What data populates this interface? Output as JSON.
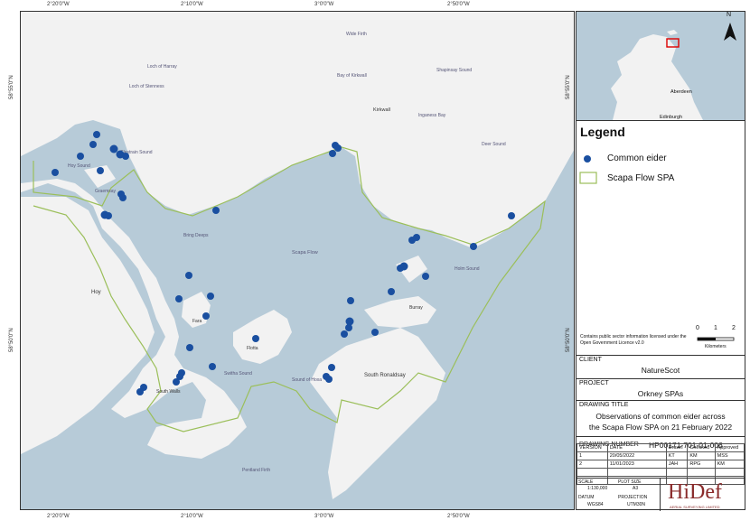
{
  "coords": {
    "top": [
      "2°20'0\"W",
      "2°10'0\"W",
      "3°0'0\"W",
      "2°50'0\"W"
    ],
    "bottom": [
      "2°20'0\"W",
      "2°10'0\"W",
      "3°0'0\"W",
      "2°50'0\"W"
    ],
    "left": [
      "58°55'0\"N",
      "58°50'0\"N"
    ],
    "right": [
      "58°55'0\"N",
      "58°50'0\"N"
    ]
  },
  "places": {
    "wide_firth": "Wide Firth",
    "loch_harray": "Loch of Harray",
    "loch_stenness": "Loch of Stenness",
    "bay_kirkwall": "Bay of Kirkwall",
    "shapinsay_sound": "Shapinsay Sound",
    "kirkwall": "Kirkwall",
    "inganess_bay": "Inganess Bay",
    "deer_sound": "Deer Sound",
    "hoy_sound": "Hoy Sound",
    "clestrain_sound": "Clestrain Sound",
    "graemsay": "Graemsay",
    "bring_deeps": "Bring Deeps",
    "scapa_flow": "Scapa Flow",
    "holm_sound": "Holm Sound",
    "burray": "Burray",
    "hoy": "Hoy",
    "flotta": "Flotta",
    "fara": "Fara",
    "switha_sound": "Switha Sound",
    "sound_hoxa": "Sound of Hoxa",
    "south_ronaldsay": "South Ronaldsay",
    "south_walls": "South Walls",
    "pentland_firth": "Pentland Firth"
  },
  "inset": {
    "north": "N",
    "aberdeen": "Aberdeen",
    "edinburgh": "Edinburgh"
  },
  "legend": {
    "title": "Legend",
    "items": [
      {
        "label": "Common eider",
        "color": "#1a4fa0"
      },
      {
        "label": "Scapa Flow SPA",
        "color": "#9bbf5a"
      }
    ]
  },
  "attribution": "Contains public sector information licensed under the Open Government Licence v2.0",
  "scalebar": {
    "ticks": [
      "0",
      "1",
      "2"
    ],
    "unit": "Kilometers"
  },
  "client": {
    "label": "CLIENT",
    "value": "NatureScot"
  },
  "project": {
    "label": "PROJECT",
    "value": "Orkney SPAs"
  },
  "drawing_title": {
    "label": "DRAWING TITLE",
    "line1": "Observations of common eider across",
    "line2": "the Scapa Flow SPA on 21 February 2022"
  },
  "drawing_number": {
    "label": "DRAWING NUMBER",
    "value": "HP00171-701-01-006"
  },
  "versions": {
    "headers": [
      "VERSION",
      "DATE",
      "Drawn",
      "Checked",
      "Approved"
    ],
    "rows": [
      [
        "1",
        "20/05/2022",
        "KT",
        "KM",
        "MSS"
      ],
      [
        "2",
        "11/01/2023",
        "JAH",
        "RPG",
        "KM"
      ]
    ]
  },
  "meta": {
    "scale_label": "SCALE",
    "scale_value": "1:130,000",
    "plot_label": "PLOT SIZE",
    "plot_value": "A3",
    "datum_label": "DATUM",
    "datum_value": "WGS84",
    "proj_label": "PROJECTION",
    "proj_value": "UTM30N"
  },
  "logo": {
    "text": "HiDef",
    "sub": "AERIAL SURVEYING LIMITED"
  },
  "colors": {
    "sea": "#b7cbd8",
    "land": "#f2f2f2",
    "dot": "#1a4fa0",
    "spa": "#9bbf5a"
  }
}
